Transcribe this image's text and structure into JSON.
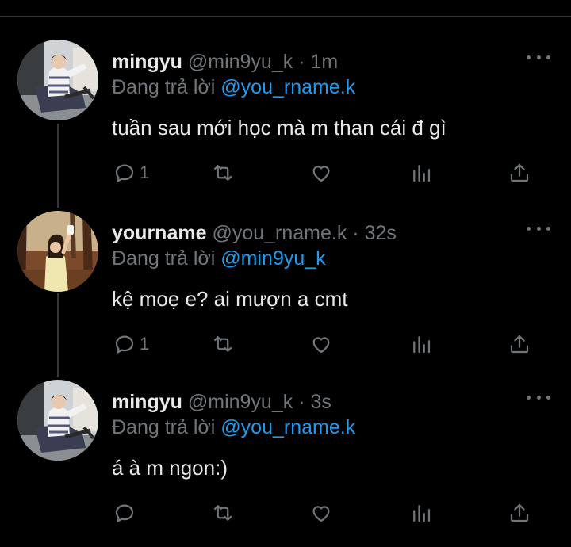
{
  "tweets": [
    {
      "display_name": "mingyu",
      "handle": "@min9yu_k",
      "separator": "·",
      "time": "1m",
      "reply_prefix": "Đang trả lời",
      "reply_to": "@you_rname.k",
      "text": "tuần sau mới học mà m than cái đ gì",
      "reply_count": "1",
      "avatar_icon": "avatar-photo-man-on-chair"
    },
    {
      "display_name": "yourname",
      "handle": "@you_rname.k",
      "separator": "·",
      "time": "32s",
      "reply_prefix": "Đang trả lời",
      "reply_to": "@min9yu_k",
      "text": "kệ moẹ e? ai mượn a cmt",
      "reply_count": "1",
      "avatar_icon": "avatar-photo-woman-in-forest"
    },
    {
      "display_name": "mingyu",
      "handle": "@min9yu_k",
      "separator": "·",
      "time": "3s",
      "reply_prefix": "Đang trả lời",
      "reply_to": "@you_rname.k",
      "text": "á à m ngon:)",
      "reply_count": "",
      "avatar_icon": "avatar-photo-man-on-chair"
    }
  ],
  "actions": [
    "reply-icon",
    "retweet-icon",
    "like-icon",
    "analytics-icon",
    "share-icon"
  ],
  "colors": {
    "background": "#000000",
    "primary_text": "#e7e9ea",
    "secondary_text": "#71767b",
    "accent": "#1d9bf0",
    "thread_line": "#333639"
  }
}
